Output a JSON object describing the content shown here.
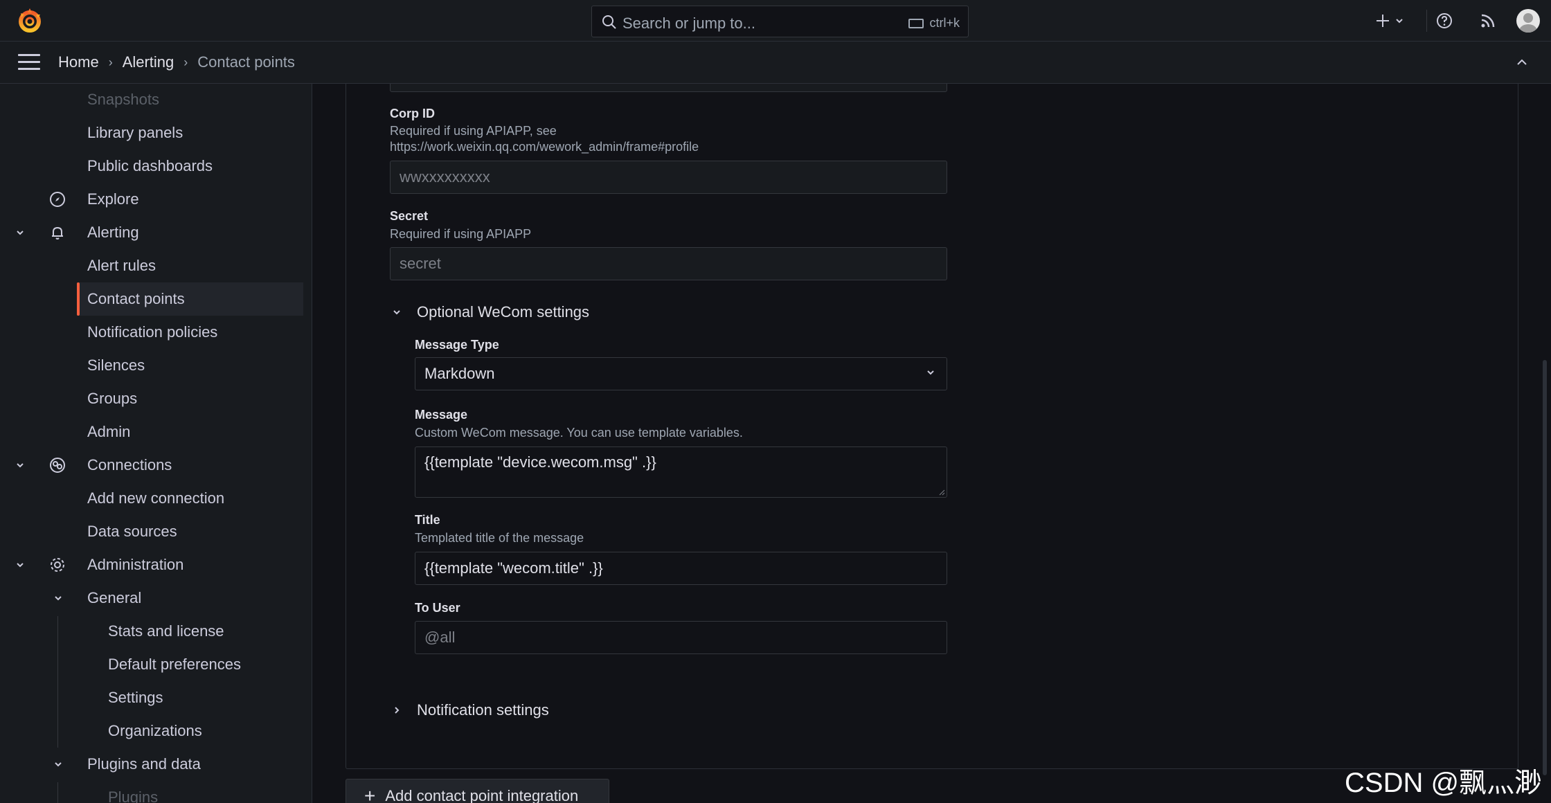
{
  "topbar": {
    "search_placeholder": "Search or jump to...",
    "search_shortcut": "ctrl+k",
    "icons": [
      "grafana-logo-icon",
      "search-icon",
      "keyboard-icon",
      "plus-icon",
      "chevron-down-icon",
      "help-icon",
      "news-rss-icon",
      "user-avatar"
    ]
  },
  "breadcrumb": {
    "items": [
      "Home",
      "Alerting",
      "Contact points"
    ]
  },
  "sidebar": {
    "items": {
      "snapshots": "Snapshots",
      "library_panels": "Library panels",
      "public_dashboards": "Public dashboards",
      "explore": "Explore",
      "alerting": "Alerting",
      "alert_rules": "Alert rules",
      "contact_points": "Contact points",
      "notification_policies": "Notification policies",
      "silences": "Silences",
      "groups": "Groups",
      "admin": "Admin",
      "connections": "Connections",
      "add_new_connection": "Add new connection",
      "data_sources": "Data sources",
      "administration": "Administration",
      "general": "General",
      "stats_and_license": "Stats and license",
      "default_preferences": "Default preferences",
      "settings": "Settings",
      "organizations": "Organizations",
      "plugins_and_data": "Plugins and data",
      "plugins": "Plugins"
    },
    "active": "Contact points",
    "accent_color": "#f55f3e"
  },
  "form": {
    "corp_id": {
      "label": "Corp ID",
      "description_line1": "Required if using APIAPP, see",
      "description_line2": "https://work.weixin.qq.com/wework_admin/frame#profile",
      "placeholder": "wwxxxxxxxxx"
    },
    "secret": {
      "label": "Secret",
      "description": "Required if using APIAPP",
      "placeholder": "secret"
    },
    "optional_section": "Optional WeCom settings",
    "message_type": {
      "label": "Message Type",
      "value": "Markdown"
    },
    "message": {
      "label": "Message",
      "description": "Custom WeCom message. You can use template variables.",
      "value": "{{template \"device.wecom.msg\" .}}"
    },
    "title": {
      "label": "Title",
      "description": "Templated title of the message",
      "value": "{{template \"wecom.title\" .}}"
    },
    "to_user": {
      "label": "To User",
      "placeholder": "@all"
    },
    "notification_settings": "Notification settings",
    "add_integration_button": "Add contact point integration"
  },
  "watermark": "CSDN @飘灬渺"
}
